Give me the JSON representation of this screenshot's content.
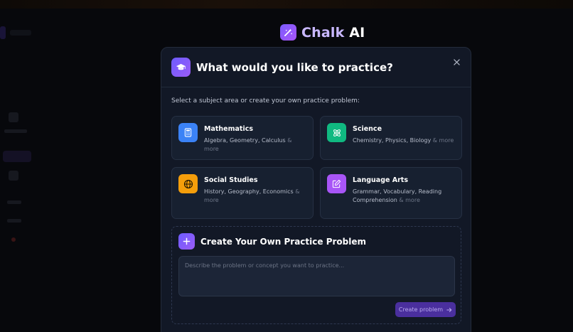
{
  "brand": {
    "name_part1": "Chalk",
    "name_part2": "AI",
    "accent": "#7b5cff"
  },
  "modal": {
    "title": "What would you like to practice?",
    "subtitle": "Select a subject area or create your own practice problem:",
    "close_icon": "close-icon"
  },
  "subjects": [
    {
      "title": "Mathematics",
      "desc": "Algebra, Geometry, Calculus",
      "more": "& more",
      "icon": "calculator-icon",
      "color": "#3b82f6"
    },
    {
      "title": "Science",
      "desc": "Chemistry, Physics, Biology",
      "more": "& more",
      "icon": "atom-icon",
      "color": "#10b981"
    },
    {
      "title": "Social Studies",
      "desc": "History, Geography, Economics",
      "more": "& more",
      "icon": "globe-icon",
      "color": "#f59e0b"
    },
    {
      "title": "Language Arts",
      "desc": "Grammar, Vocabulary, Reading Comprehension",
      "more": "& more",
      "icon": "pencil-edit-icon",
      "color": "#a855f7"
    }
  ],
  "create": {
    "title": "Create Your Own Practice Problem",
    "placeholder": "Describe the problem or concept you want to practice...",
    "button_label": "Create problem"
  }
}
